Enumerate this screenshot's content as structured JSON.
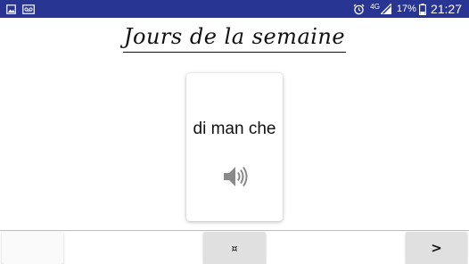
{
  "status_bar": {
    "left_icons": [
      "image-icon",
      "voicemail-icon"
    ],
    "right_icons": [
      "alarm-icon",
      "signal-icon"
    ],
    "network": "4G",
    "battery_percent": "17%",
    "time": "21:27",
    "color": "#283593"
  },
  "title": "Jours de la semaine",
  "card": {
    "word": "di man che",
    "audio_icon": "speaker-icon"
  },
  "bottom_bar": {
    "left_button_label": "",
    "middle_button_label": "¤",
    "right_button_label": ">"
  }
}
